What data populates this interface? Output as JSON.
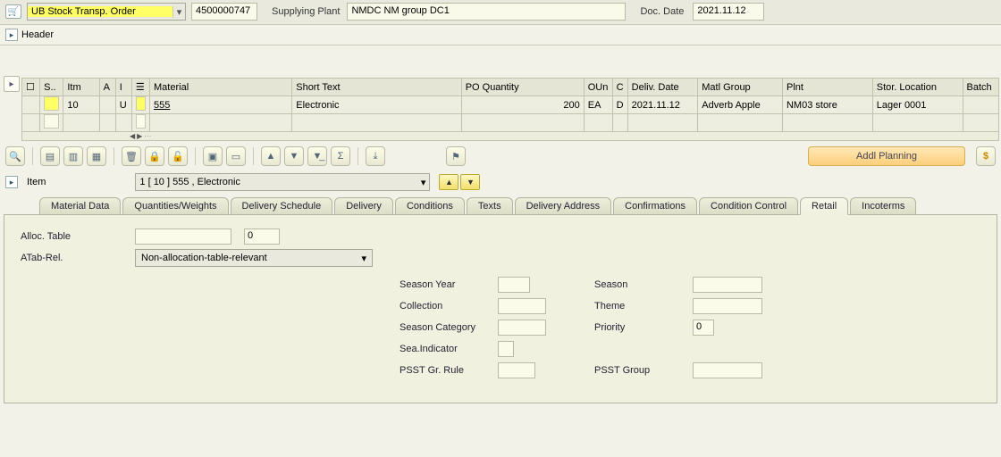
{
  "header": {
    "doc_type": "UB Stock Transp. Order",
    "doc_number": "4500000747",
    "supplying_plant_label": "Supplying Plant",
    "supplying_plant": "NMDC NM group DC1",
    "doc_date_label": "Doc. Date",
    "doc_date": "2021.11.12",
    "header_toggle": "Header"
  },
  "grid": {
    "cols": {
      "sel": "S..",
      "itm": "Itm",
      "a": "A",
      "i": "I",
      "mat_icon": "",
      "material": "Material",
      "short": "Short Text",
      "poq": "PO Quantity",
      "oun": "OUn",
      "c": "C",
      "deliv": "Deliv. Date",
      "matg": "Matl Group",
      "plnt": "Plnt",
      "stor": "Stor. Location",
      "batch": "Batch"
    },
    "rows": [
      {
        "itm": "10",
        "a": "",
        "i": "U",
        "material": "555",
        "short": "Electronic",
        "poq": "200",
        "oun": "EA",
        "c": "D",
        "deliv": "2021.11.12",
        "matg": "Adverb Apple",
        "plnt": "NM03 store",
        "stor": "Lager 0001",
        "batch": ""
      }
    ]
  },
  "toolbar": {
    "addl_planning": "Addl Planning"
  },
  "item_selector": {
    "label": "Item",
    "value": "1 [ 10 ] 555 , Electronic"
  },
  "tabs": [
    "Material Data",
    "Quantities/Weights",
    "Delivery Schedule",
    "Delivery",
    "Conditions",
    "Texts",
    "Delivery Address",
    "Confirmations",
    "Condition Control",
    "Retail",
    "Incoterms"
  ],
  "active_tab": "Retail",
  "retail": {
    "alloc_table_label": "Alloc. Table",
    "alloc_table": "",
    "alloc_table_num": "0",
    "atab_rel_label": "ATab-Rel.",
    "atab_rel": "Non-allocation-table-relevant",
    "season_year_label": "Season Year",
    "season_year": "",
    "collection_label": "Collection",
    "collection": "",
    "season_cat_label": "Season Category",
    "season_cat": "",
    "sea_ind_label": "Sea.Indicator",
    "sea_ind": "",
    "psst_rule_label": "PSST Gr. Rule",
    "psst_rule": "",
    "season_label": "Season",
    "season": "",
    "theme_label": "Theme",
    "theme": "",
    "priority_label": "Priority",
    "priority": "0",
    "psst_group_label": "PSST Group",
    "psst_group": ""
  }
}
